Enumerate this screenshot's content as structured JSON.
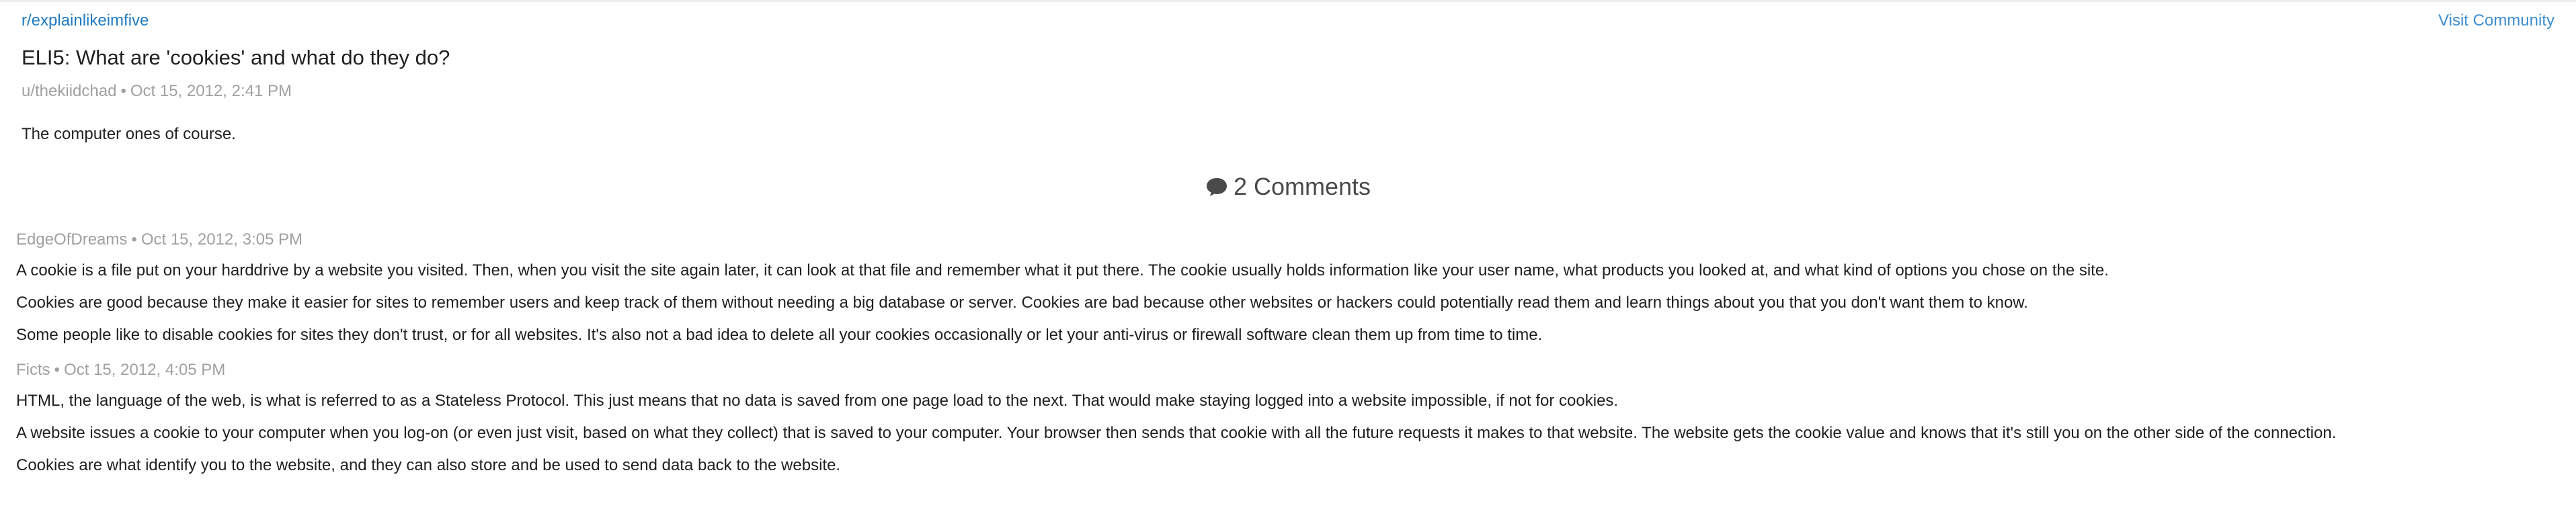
{
  "post": {
    "subreddit": "r/explainlikeimfive",
    "visit_label": "Visit Community",
    "title": "ELI5: What are 'cookies' and what do they do?",
    "author": "u/thekiidchad",
    "timestamp": "Oct 15, 2012, 2:41 PM",
    "body": "The computer ones of course."
  },
  "comments_header": {
    "label": "2 Comments",
    "icon": "speech-bubble-icon"
  },
  "comments": [
    {
      "author": "EdgeOfDreams",
      "timestamp": "Oct 15, 2012, 3:05 PM",
      "paragraphs": [
        "A cookie is a file put on your harddrive by a website you visited. Then, when you visit the site again later, it can look at that file and remember what it put there. The cookie usually holds information like your user name, what products you looked at, and what kind of options you chose on the site.",
        "Cookies are good because they make it easier for sites to remember users and keep track of them without needing a big database or server. Cookies are bad because other websites or hackers could potentially read them and learn things about you that you don't want them to know.",
        "Some people like to disable cookies for sites they don't trust, or for all websites. It's also not a bad idea to delete all your cookies occasionally or let your anti-virus or firewall software clean them up from time to time."
      ]
    },
    {
      "author": "Ficts",
      "timestamp": "Oct 15, 2012, 4:05 PM",
      "paragraphs": [
        "HTML, the language of the web, is what is referred to as a Stateless Protocol. This just means that no data is saved from one page load to the next. That would make staying logged into a website impossible, if not for cookies.",
        "A website issues a cookie to your computer when you log-on (or even just visit, based on what they collect) that is saved to your computer. Your browser then sends that cookie with all the future requests it makes to that website. The website gets the cookie value and knows that it's still you on the other side of the connection.",
        "Cookies are what identify you to the website, and they can also store and be used to send data back to the website."
      ]
    }
  ],
  "separator": "•",
  "colors": {
    "link": "#1f7bc1",
    "meta": "#a0a0a0",
    "text": "#1f1f1f"
  }
}
